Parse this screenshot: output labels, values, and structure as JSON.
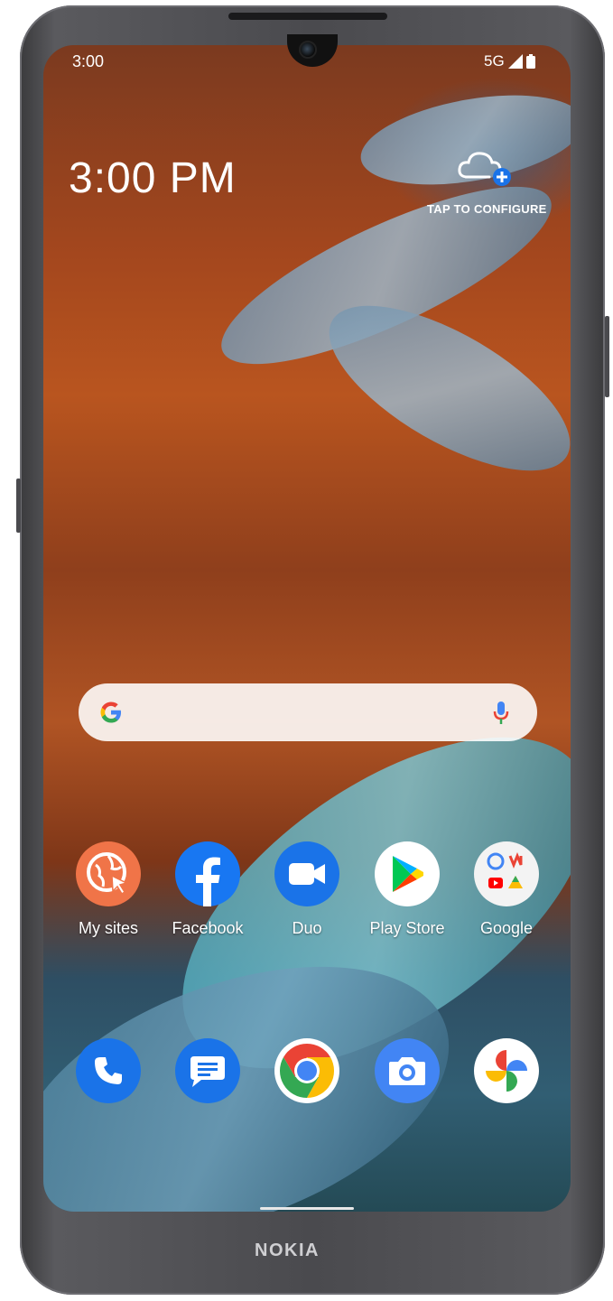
{
  "status_bar": {
    "time": "3:00",
    "network": "5G"
  },
  "clock_widget": {
    "time": "3:00 PM"
  },
  "weather_widget": {
    "label": "TAP TO CONFIGURE"
  },
  "search_bar": {
    "google_logo": "google-g-icon",
    "mic": "microphone-icon"
  },
  "apps_row": [
    {
      "label": "My sites",
      "icon": "globe-cursor-icon",
      "color": "#f07040"
    },
    {
      "label": "Facebook",
      "icon": "facebook-icon",
      "color": "#1877f2"
    },
    {
      "label": "Duo",
      "icon": "video-camera-icon",
      "color": "#1a73e8"
    },
    {
      "label": "Play Store",
      "icon": "play-store-icon",
      "color": "#ffffff"
    },
    {
      "label": "Google",
      "icon": "google-folder-icon",
      "color": "#ffffff"
    }
  ],
  "dock": [
    {
      "icon": "phone-icon",
      "color": "#1a73e8"
    },
    {
      "icon": "messages-icon",
      "color": "#1a73e8"
    },
    {
      "icon": "chrome-icon",
      "color": "#ffffff"
    },
    {
      "icon": "camera-icon",
      "color": "#4285f4"
    },
    {
      "icon": "photos-icon",
      "color": "#ffffff"
    }
  ],
  "device": {
    "brand": "NOKIA"
  }
}
